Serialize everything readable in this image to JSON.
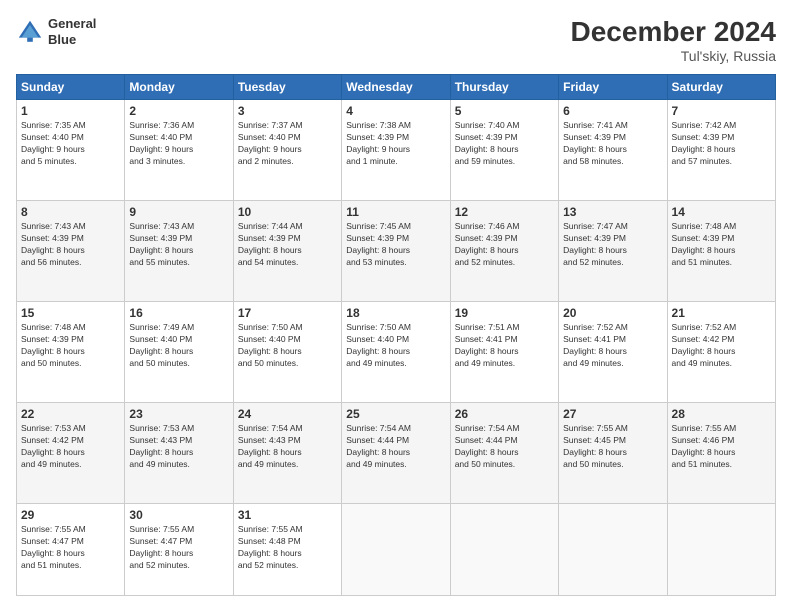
{
  "header": {
    "logo_line1": "General",
    "logo_line2": "Blue",
    "main_title": "December 2024",
    "subtitle": "Tul'skiy, Russia"
  },
  "columns": [
    "Sunday",
    "Monday",
    "Tuesday",
    "Wednesday",
    "Thursday",
    "Friday",
    "Saturday"
  ],
  "weeks": [
    [
      {
        "day": "1",
        "info": "Sunrise: 7:35 AM\nSunset: 4:40 PM\nDaylight: 9 hours\nand 5 minutes."
      },
      {
        "day": "2",
        "info": "Sunrise: 7:36 AM\nSunset: 4:40 PM\nDaylight: 9 hours\nand 3 minutes."
      },
      {
        "day": "3",
        "info": "Sunrise: 7:37 AM\nSunset: 4:40 PM\nDaylight: 9 hours\nand 2 minutes."
      },
      {
        "day": "4",
        "info": "Sunrise: 7:38 AM\nSunset: 4:39 PM\nDaylight: 9 hours\nand 1 minute."
      },
      {
        "day": "5",
        "info": "Sunrise: 7:40 AM\nSunset: 4:39 PM\nDaylight: 8 hours\nand 59 minutes."
      },
      {
        "day": "6",
        "info": "Sunrise: 7:41 AM\nSunset: 4:39 PM\nDaylight: 8 hours\nand 58 minutes."
      },
      {
        "day": "7",
        "info": "Sunrise: 7:42 AM\nSunset: 4:39 PM\nDaylight: 8 hours\nand 57 minutes."
      }
    ],
    [
      {
        "day": "8",
        "info": "Sunrise: 7:43 AM\nSunset: 4:39 PM\nDaylight: 8 hours\nand 56 minutes."
      },
      {
        "day": "9",
        "info": "Sunrise: 7:43 AM\nSunset: 4:39 PM\nDaylight: 8 hours\nand 55 minutes."
      },
      {
        "day": "10",
        "info": "Sunrise: 7:44 AM\nSunset: 4:39 PM\nDaylight: 8 hours\nand 54 minutes."
      },
      {
        "day": "11",
        "info": "Sunrise: 7:45 AM\nSunset: 4:39 PM\nDaylight: 8 hours\nand 53 minutes."
      },
      {
        "day": "12",
        "info": "Sunrise: 7:46 AM\nSunset: 4:39 PM\nDaylight: 8 hours\nand 52 minutes."
      },
      {
        "day": "13",
        "info": "Sunrise: 7:47 AM\nSunset: 4:39 PM\nDaylight: 8 hours\nand 52 minutes."
      },
      {
        "day": "14",
        "info": "Sunrise: 7:48 AM\nSunset: 4:39 PM\nDaylight: 8 hours\nand 51 minutes."
      }
    ],
    [
      {
        "day": "15",
        "info": "Sunrise: 7:48 AM\nSunset: 4:39 PM\nDaylight: 8 hours\nand 50 minutes."
      },
      {
        "day": "16",
        "info": "Sunrise: 7:49 AM\nSunset: 4:40 PM\nDaylight: 8 hours\nand 50 minutes."
      },
      {
        "day": "17",
        "info": "Sunrise: 7:50 AM\nSunset: 4:40 PM\nDaylight: 8 hours\nand 50 minutes."
      },
      {
        "day": "18",
        "info": "Sunrise: 7:50 AM\nSunset: 4:40 PM\nDaylight: 8 hours\nand 49 minutes."
      },
      {
        "day": "19",
        "info": "Sunrise: 7:51 AM\nSunset: 4:41 PM\nDaylight: 8 hours\nand 49 minutes."
      },
      {
        "day": "20",
        "info": "Sunrise: 7:52 AM\nSunset: 4:41 PM\nDaylight: 8 hours\nand 49 minutes."
      },
      {
        "day": "21",
        "info": "Sunrise: 7:52 AM\nSunset: 4:42 PM\nDaylight: 8 hours\nand 49 minutes."
      }
    ],
    [
      {
        "day": "22",
        "info": "Sunrise: 7:53 AM\nSunset: 4:42 PM\nDaylight: 8 hours\nand 49 minutes."
      },
      {
        "day": "23",
        "info": "Sunrise: 7:53 AM\nSunset: 4:43 PM\nDaylight: 8 hours\nand 49 minutes."
      },
      {
        "day": "24",
        "info": "Sunrise: 7:54 AM\nSunset: 4:43 PM\nDaylight: 8 hours\nand 49 minutes."
      },
      {
        "day": "25",
        "info": "Sunrise: 7:54 AM\nSunset: 4:44 PM\nDaylight: 8 hours\nand 49 minutes."
      },
      {
        "day": "26",
        "info": "Sunrise: 7:54 AM\nSunset: 4:44 PM\nDaylight: 8 hours\nand 50 minutes."
      },
      {
        "day": "27",
        "info": "Sunrise: 7:55 AM\nSunset: 4:45 PM\nDaylight: 8 hours\nand 50 minutes."
      },
      {
        "day": "28",
        "info": "Sunrise: 7:55 AM\nSunset: 4:46 PM\nDaylight: 8 hours\nand 51 minutes."
      }
    ],
    [
      {
        "day": "29",
        "info": "Sunrise: 7:55 AM\nSunset: 4:47 PM\nDaylight: 8 hours\nand 51 minutes."
      },
      {
        "day": "30",
        "info": "Sunrise: 7:55 AM\nSunset: 4:47 PM\nDaylight: 8 hours\nand 52 minutes."
      },
      {
        "day": "31",
        "info": "Sunrise: 7:55 AM\nSunset: 4:48 PM\nDaylight: 8 hours\nand 52 minutes."
      },
      {
        "day": "",
        "info": ""
      },
      {
        "day": "",
        "info": ""
      },
      {
        "day": "",
        "info": ""
      },
      {
        "day": "",
        "info": ""
      }
    ]
  ]
}
